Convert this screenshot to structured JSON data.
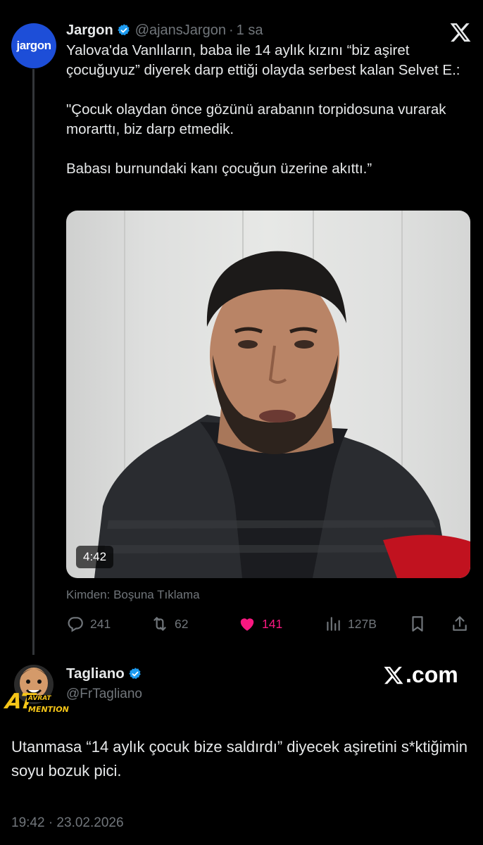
{
  "tweet": {
    "avatar_text": "jargon",
    "name": "Jargon",
    "handle": "@ajansJargon",
    "time": "1 sa",
    "text": "Yalova'da Vanlıların, baba ile 14 aylık kızını “biz aşiret çocuğuyuz” diyerek darp ettiği olayda serbest kalan Selvet E.:\n\n\"Çocuk olaydan önce gözünü arabanın torpidosuna vurarak morarttı, biz darp etmedik.\n\nBabası burnundaki kanı çocuğun üzerine akıttı.”",
    "video_duration": "4:42",
    "source_line": "Kimden: Boşuna Tıklama",
    "stats": {
      "replies": "241",
      "reposts": "62",
      "likes": "141",
      "views": "127B"
    },
    "liked": true,
    "like_color": "#f91880",
    "verified_color": "#1d9bf0"
  },
  "reply": {
    "name": "Tagliano",
    "handle": "@FrTagliano",
    "avatar_text_top": "AVRAT",
    "avatar_text_big": "AT",
    "avatar_text_bottom": "MENTION",
    "brand_text": ".com",
    "text": "Utanmasa “14 aylık çocuk bize saldırdı” diyecek aşiretini s*ktiğimin soyu bozuk pici.",
    "timestamp": "19:42 · 23.02.2026"
  }
}
